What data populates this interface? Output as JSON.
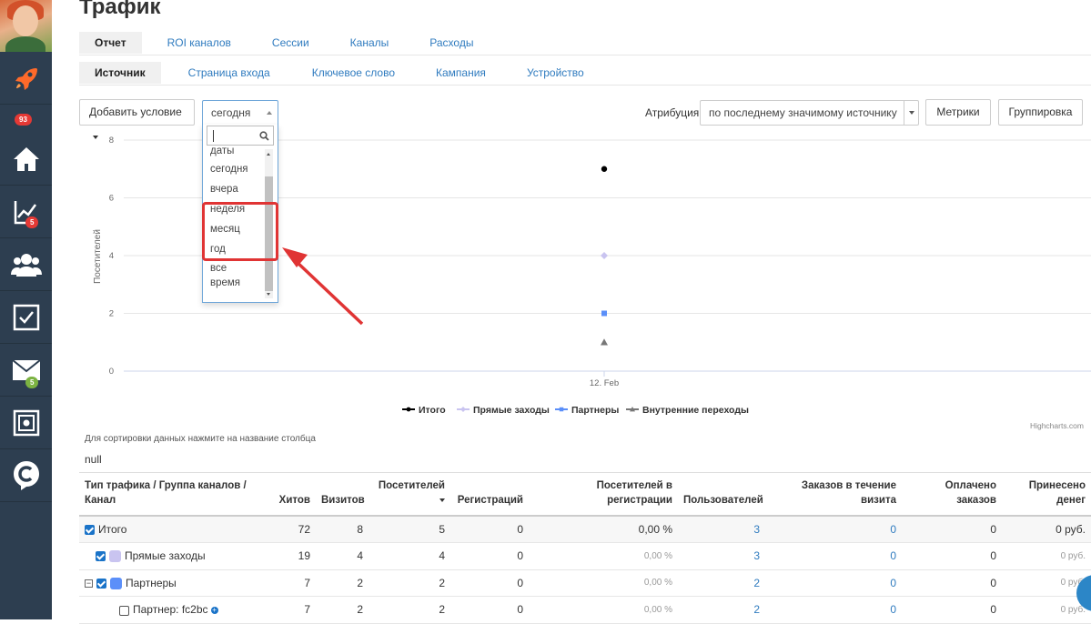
{
  "page_title": "Трафик",
  "tabs_main": [
    "Отчет",
    "ROI каналов",
    "Сессии",
    "Каналы",
    "Расходы"
  ],
  "tabs_sub": [
    "Источник",
    "Страница входа",
    "Ключевое слово",
    "Кампания",
    "Устройство"
  ],
  "sidebar": {
    "badges": {
      "rocket": "93",
      "stats": "5",
      "mail": "5"
    },
    "icons": [
      "rocket-icon",
      "home-icon",
      "chart-icon",
      "users-icon",
      "tasks-icon",
      "mail-icon",
      "safe-icon",
      "app-logo-icon"
    ]
  },
  "controls": {
    "add_condition": "Добавить условие",
    "period_value": "сегодня",
    "attribution_label": "Атрибуция",
    "attribution_value": "по последнему значимому источнику",
    "metrics_button": "Метрики",
    "grouping_button": "Группировка"
  },
  "dropdown": {
    "options": [
      "даты",
      "сегодня",
      "вчера",
      "неделя",
      "месяц",
      "год",
      "все время"
    ],
    "highlighted": [
      "неделя",
      "месяц",
      "год"
    ]
  },
  "chart_data": {
    "type": "scatter",
    "ylabel": "Посетителей",
    "y_ticks": [
      "0",
      "2",
      "4",
      "6",
      "8"
    ],
    "ylim": [
      0,
      8
    ],
    "categories": [
      "12. Feb"
    ],
    "series": [
      {
        "name": "Итого",
        "values": [
          7
        ],
        "color": "#000000",
        "marker": "circle"
      },
      {
        "name": "Прямые заходы",
        "values": [
          4
        ],
        "color": "#c9c4f0",
        "marker": "diamond"
      },
      {
        "name": "Партнеры",
        "values": [
          2
        ],
        "color": "#5b8ff9",
        "marker": "square"
      },
      {
        "name": "Внутренние переходы",
        "values": [
          1
        ],
        "color": "#777777",
        "marker": "triangle"
      }
    ],
    "credit": "Highcharts.com",
    "legend_position": "bottom-center",
    "grid": true
  },
  "footnote": "Для сортировки данных нажмите на название столбца",
  "null_text": "null",
  "table": {
    "headers": [
      "Тип трафика / Группа каналов / Канал",
      "Хитов",
      "Визитов",
      "Посетителей",
      "Регистраций",
      "Посетителей в регистрации",
      "Пользователей",
      "Заказов в течение визита",
      "Оплачено заказов",
      "Принесено денег"
    ],
    "rows": [
      {
        "name": "Итого",
        "hits": "72",
        "visits": "8",
        "visitors": "5",
        "reg": "0",
        "conv": "0,00 %",
        "users": "3",
        "orders": "0",
        "paid": "0",
        "money": "0 руб."
      },
      {
        "name": "Прямые заходы",
        "hits": "19",
        "visits": "4",
        "visitors": "4",
        "reg": "0",
        "conv": "0,00 %",
        "users": "3",
        "orders": "0",
        "paid": "0",
        "money": "0 руб."
      },
      {
        "name": "Партнеры",
        "hits": "7",
        "visits": "2",
        "visitors": "2",
        "reg": "0",
        "conv": "0,00 %",
        "users": "2",
        "orders": "0",
        "paid": "0",
        "money": "0 руб."
      },
      {
        "name": "Партнер: fc2bc",
        "hits": "7",
        "visits": "2",
        "visitors": "2",
        "reg": "0",
        "conv": "0,00 %",
        "users": "2",
        "orders": "0",
        "paid": "0",
        "money": "0 руб."
      }
    ]
  }
}
